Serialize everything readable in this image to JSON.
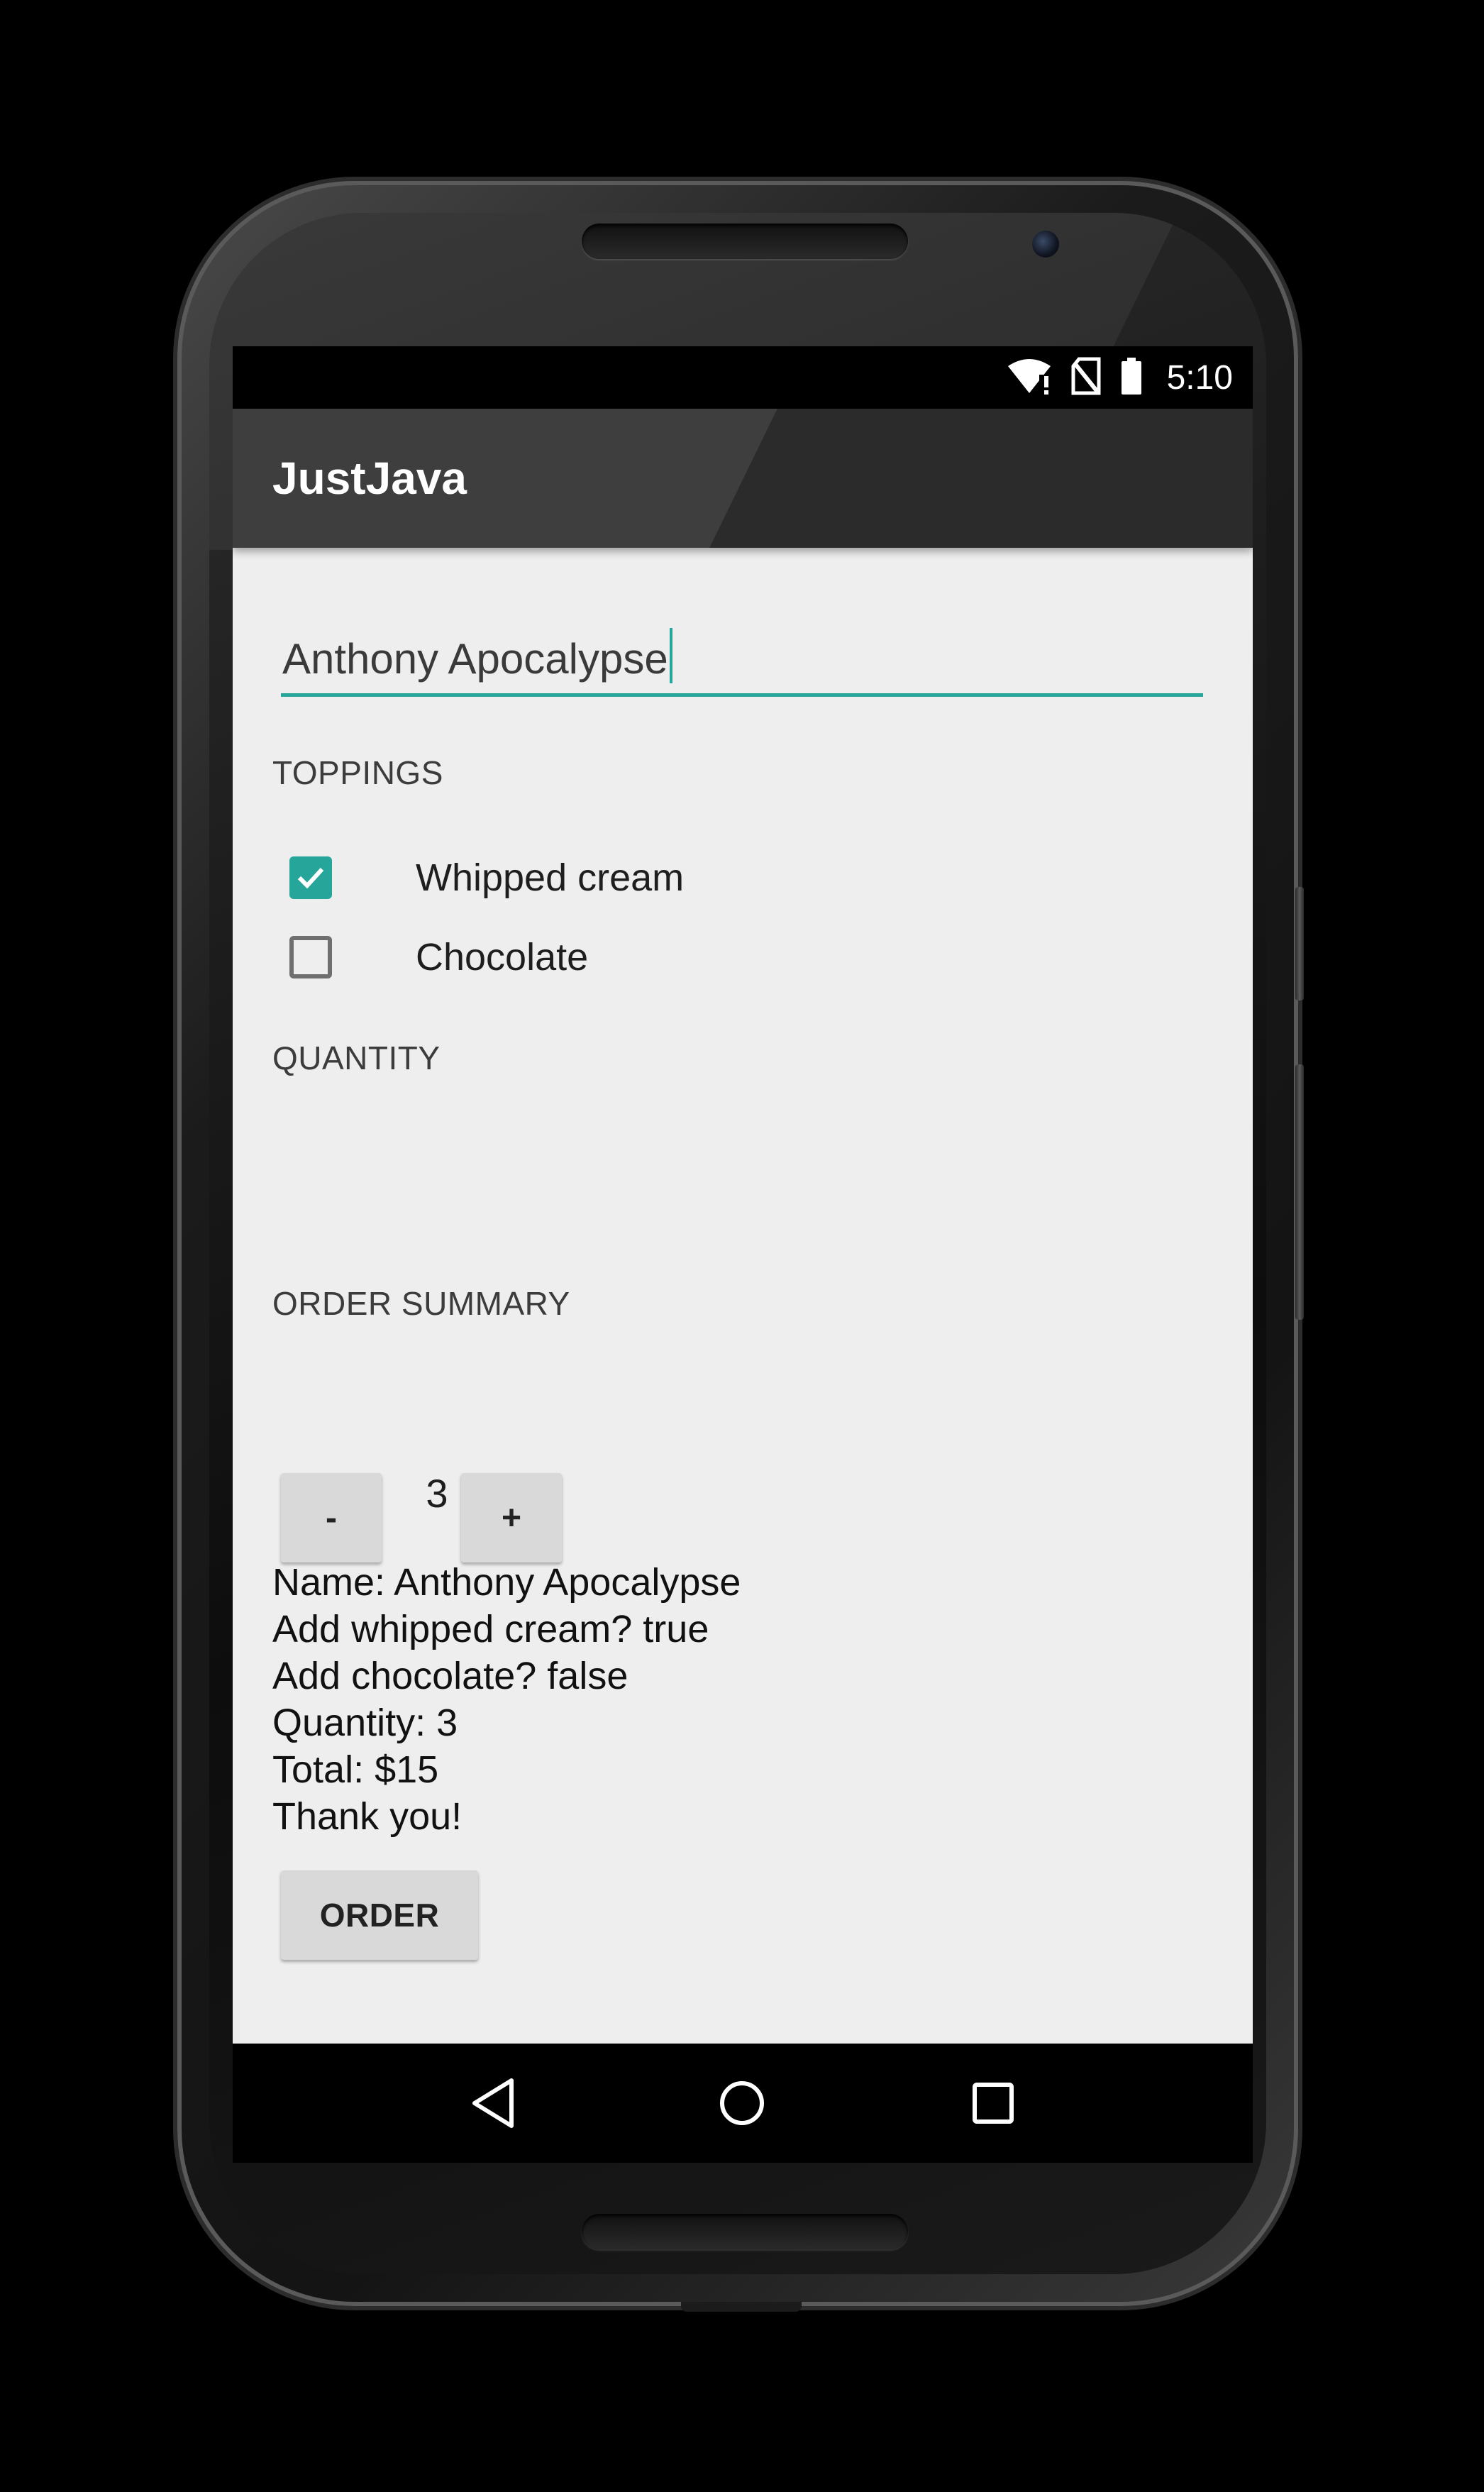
{
  "status_bar": {
    "time": "5:10",
    "icons": [
      "wifi-warning-icon",
      "no-sim-icon",
      "battery-icon"
    ]
  },
  "app_bar": {
    "title": "JustJava"
  },
  "name_input": {
    "value": "Anthony Apocalypse"
  },
  "toppings": {
    "header": "TOPPINGS",
    "items": [
      {
        "label": "Whipped cream",
        "checked": true
      },
      {
        "label": "Chocolate",
        "checked": false
      }
    ]
  },
  "quantity": {
    "header": "QUANTITY",
    "decrement_label": "-",
    "value": "3",
    "increment_label": "+"
  },
  "order_summary": {
    "header": "ORDER SUMMARY",
    "lines": [
      "Name: Anthony Apocalypse",
      "Add whipped cream? true",
      "Add chocolate? false",
      "Quantity: 3",
      "Total: $15",
      "Thank you!"
    ]
  },
  "order_button": {
    "label": "ORDER"
  },
  "nav_bar": {
    "icons": [
      "back-icon",
      "home-icon",
      "recents-icon"
    ]
  },
  "colors": {
    "accent": "#26a69a",
    "app_bar": "#2b2b2b",
    "background": "#eeeeee",
    "button": "#d9d9d9"
  }
}
